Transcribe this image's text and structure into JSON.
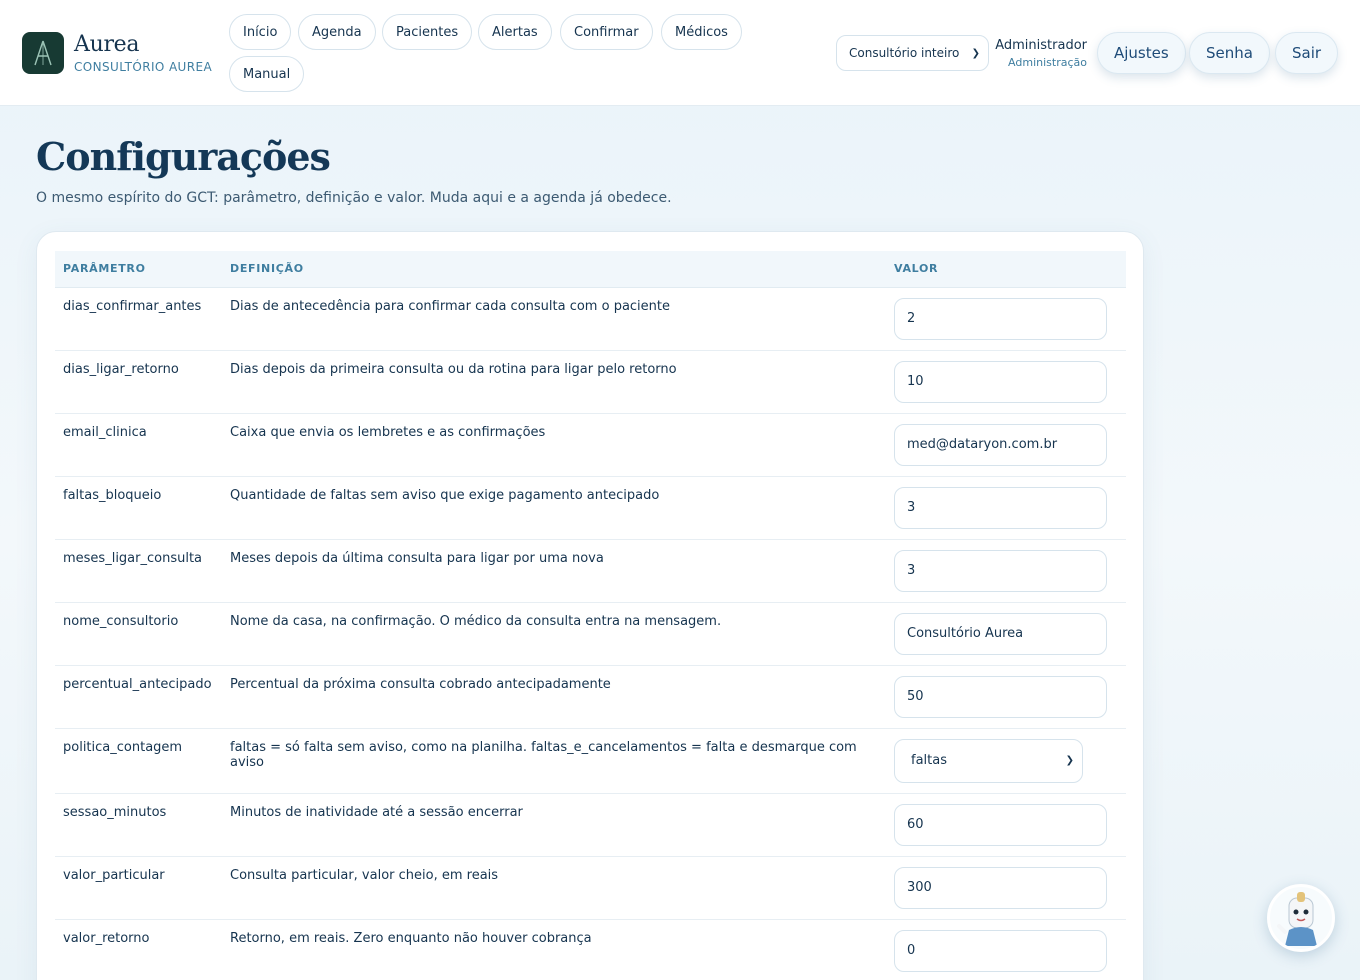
{
  "brand": {
    "name": "Aurea",
    "subtitle": "CONSULTÓRIO AUREA"
  },
  "nav": {
    "items": [
      {
        "label": "Início"
      },
      {
        "label": "Agenda"
      },
      {
        "label": "Pacientes"
      },
      {
        "label": "Alertas"
      },
      {
        "label": "Confirmar"
      },
      {
        "label": "Médicos"
      },
      {
        "label": "Manual"
      }
    ]
  },
  "scope": {
    "selected": "Consultório inteiro"
  },
  "user": {
    "name": "Administrador",
    "role": "Administração"
  },
  "actions": {
    "settings": "Ajustes",
    "password": "Senha",
    "logout": "Sair"
  },
  "page": {
    "title": "Configurações",
    "subtitle": "O mesmo espírito do GCT: parâmetro, definição e valor. Muda aqui e a agenda já obedece."
  },
  "table": {
    "headers": {
      "param": "PARÂMETRO",
      "def": "DEFINIÇÃO",
      "value": "VALOR"
    },
    "rows": [
      {
        "param": "dias_confirmar_antes",
        "def": "Dias de antecedência para confirmar cada consulta com o paciente",
        "value": "2"
      },
      {
        "param": "dias_ligar_retorno",
        "def": "Dias depois da primeira consulta ou da rotina para ligar pelo retorno",
        "value": "10"
      },
      {
        "param": "email_clinica",
        "def": "Caixa que envia os lembretes e as confirmações",
        "value": "med@dataryon.com.br"
      },
      {
        "param": "faltas_bloqueio",
        "def": "Quantidade de faltas sem aviso que exige pagamento antecipado",
        "value": "3"
      },
      {
        "param": "meses_ligar_consulta",
        "def": "Meses depois da última consulta para ligar por uma nova",
        "value": "3"
      },
      {
        "param": "nome_consultorio",
        "def": "Nome da casa, na confirmação. O médico da consulta entra na mensagem.",
        "value": "Consultório Aurea"
      },
      {
        "param": "percentual_antecipado",
        "def": "Percentual da próxima consulta cobrado antecipadamente",
        "value": "50"
      },
      {
        "param": "politica_contagem",
        "def": "faltas = só falta sem aviso, como na planilha. faltas_e_cancelamentos = falta e desmarque com aviso",
        "value": "faltas"
      },
      {
        "param": "sessao_minutos",
        "def": "Minutos de inatividade até a sessão encerrar",
        "value": "60"
      },
      {
        "param": "valor_particular",
        "def": "Consulta particular, valor cheio, em reais",
        "value": "300"
      },
      {
        "param": "valor_retorno",
        "def": "Retorno, em reais. Zero enquanto não houver cobrança",
        "value": "0"
      }
    ]
  }
}
